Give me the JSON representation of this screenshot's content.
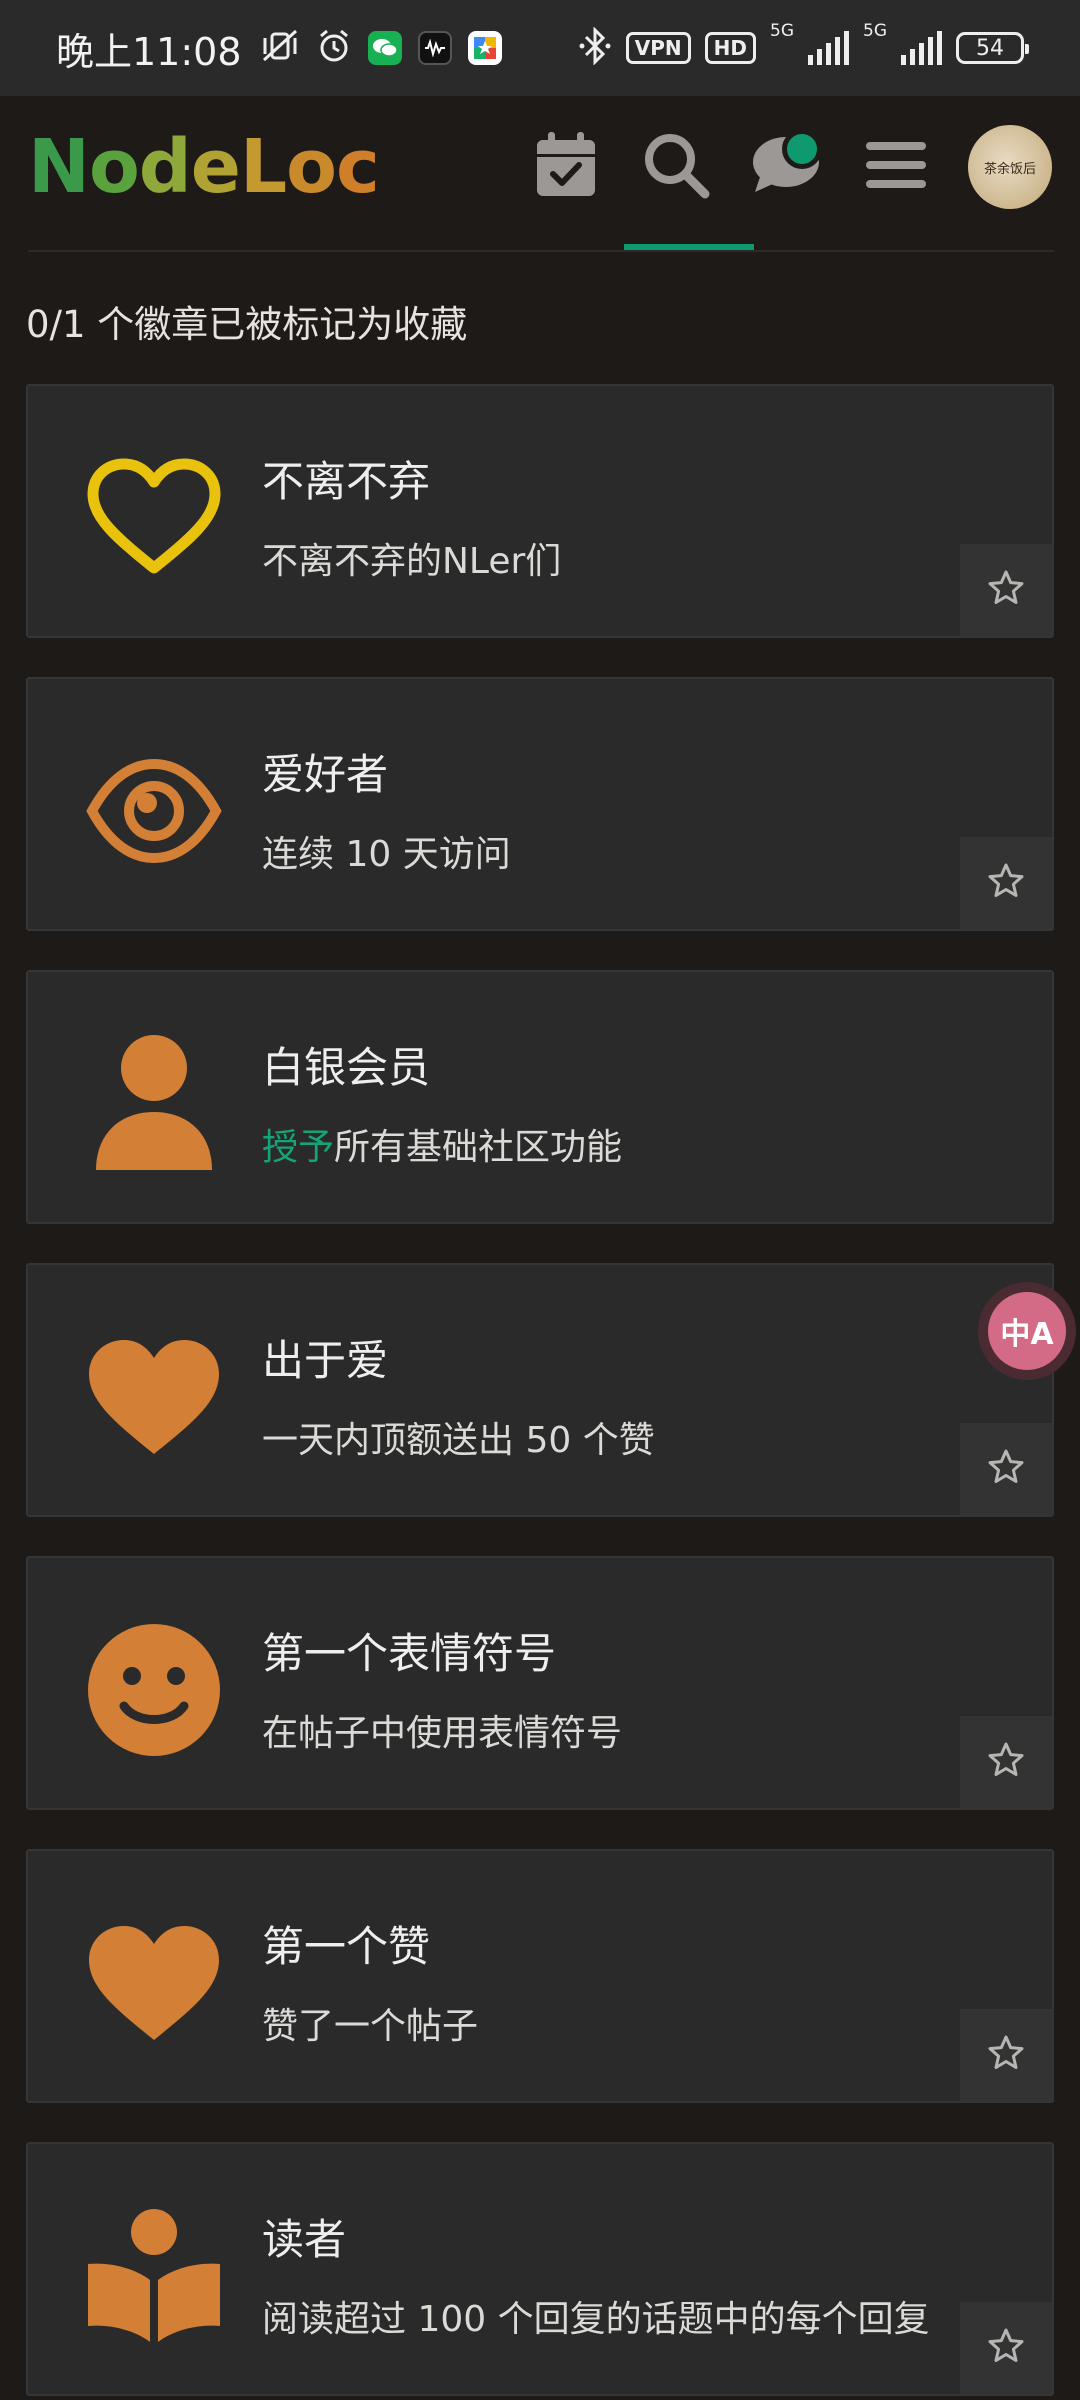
{
  "status_bar": {
    "time": "晚上11:08",
    "vpn_label": "VPN",
    "hd_label": "HD",
    "network_1": "5G",
    "network_2": "5G",
    "battery": "54"
  },
  "header": {
    "logo": [
      "N",
      "o",
      "d",
      "e",
      "L",
      "o",
      "c"
    ],
    "avatar_text": "茶余饭后",
    "accent_color": "#0e9a6e"
  },
  "summary": "0/1 个徽章已被标记为收藏",
  "badges": [
    {
      "title": "不离不弃",
      "desc": "不离不弃的NLer们",
      "icon": "heart-outline-icon",
      "color": "#e8c20c"
    },
    {
      "title": "爱好者",
      "desc": "连续 10 天访问",
      "icon": "eye-icon",
      "color": "#d37f35"
    },
    {
      "title": "白银会员",
      "desc_link": "授予",
      "desc_rest": "所有基础社区功能",
      "icon": "user-icon",
      "color": "#d37f35"
    },
    {
      "title": "出于爱",
      "desc": "一天内顶额送出 50 个赞",
      "icon": "heart-icon",
      "color": "#d37f35"
    },
    {
      "title": "第一个表情符号",
      "desc": "在帖子中使用表情符号",
      "icon": "smile-icon",
      "color": "#d37f35"
    },
    {
      "title": "第一个赞",
      "desc": "赞了一个帖子",
      "icon": "heart-icon",
      "color": "#d37f35"
    },
    {
      "title": "读者",
      "desc": "阅读超过 100 个回复的话题中的每个回复",
      "icon": "book-reader-icon",
      "color": "#d37f35"
    }
  ],
  "translate_fab_label": "中A"
}
